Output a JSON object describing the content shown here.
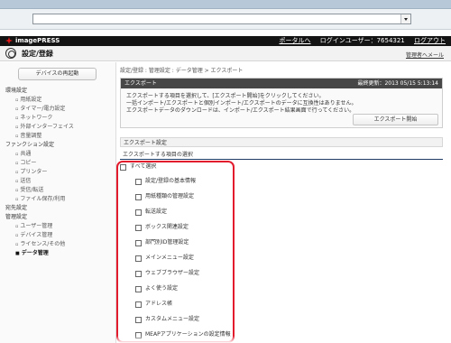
{
  "browser": {
    "colors": {
      "strip": "#b7c9d9",
      "address_bg": "#ffffff"
    },
    "icons": {
      "dropdown": "chevron-down-icon"
    }
  },
  "top_bar": {
    "brand": "imagePRESS",
    "portal_link": "ポータルへ",
    "login_user": "ログインユーザー：7654321",
    "logout_link": "ログアウト"
  },
  "header": {
    "title": "設定/登録",
    "manager_link": "管理者へメール"
  },
  "sidebar": {
    "restart_button": "デバイスの再起動",
    "items": [
      {
        "label": "環境設定",
        "type": "section"
      },
      {
        "label": "用紙設定",
        "type": "child"
      },
      {
        "label": "タイマー/電力設定",
        "type": "child"
      },
      {
        "label": "ネットワーク",
        "type": "child"
      },
      {
        "label": "外部インターフェイス",
        "type": "child"
      },
      {
        "label": "音量調整",
        "type": "child"
      },
      {
        "label": "ファンクション設定",
        "type": "section"
      },
      {
        "label": "共通",
        "type": "child"
      },
      {
        "label": "コピー",
        "type": "child"
      },
      {
        "label": "プリンター",
        "type": "child"
      },
      {
        "label": "送信",
        "type": "child"
      },
      {
        "label": "受信/転送",
        "type": "child"
      },
      {
        "label": "ファイル保存/利用",
        "type": "child"
      },
      {
        "label": "宛先設定",
        "type": "section"
      },
      {
        "label": "管理設定",
        "type": "section"
      },
      {
        "label": "ユーザー管理",
        "type": "child"
      },
      {
        "label": "デバイス管理",
        "type": "child"
      },
      {
        "label": "ライセンス/その他",
        "type": "child"
      },
      {
        "label": "データ管理",
        "type": "active"
      }
    ]
  },
  "main": {
    "breadcrumb": "設定/登録 : 管理設定 : データ管理 > エクスポート",
    "panel": {
      "title": "エクスポート",
      "last_updated": "最終更新：2013 05/15 5:13:14",
      "notice_lines": [
        "エクスポートする項目を選択して、[エクスポート開始]をクリックしてください。",
        "一括インポート/エクスポートと個別インポート/エクスポートのデータに互換性はありません。",
        "エクスポートデータのダウンロードは、インポート/エクスポート結果画面で行ってください。"
      ],
      "export_button": "エクスポート開始"
    },
    "settings_header": "エクスポート設定",
    "items_header": "エクスポートする項目の選択",
    "select_all_label": "すべて選択",
    "items": [
      "設定/登録の基本情報",
      "用紙種類の管理設定",
      "転送設定",
      "ボックス関連設定",
      "部門別ID管理設定",
      "メインメニュー設定",
      "ウェブブラウザー設定",
      "よく使う設定",
      "アドレス帳",
      "カスタムメニュー設定",
      "MEAPアプリケーションの設定情報"
    ],
    "highlight_color": "#e21b2d"
  }
}
